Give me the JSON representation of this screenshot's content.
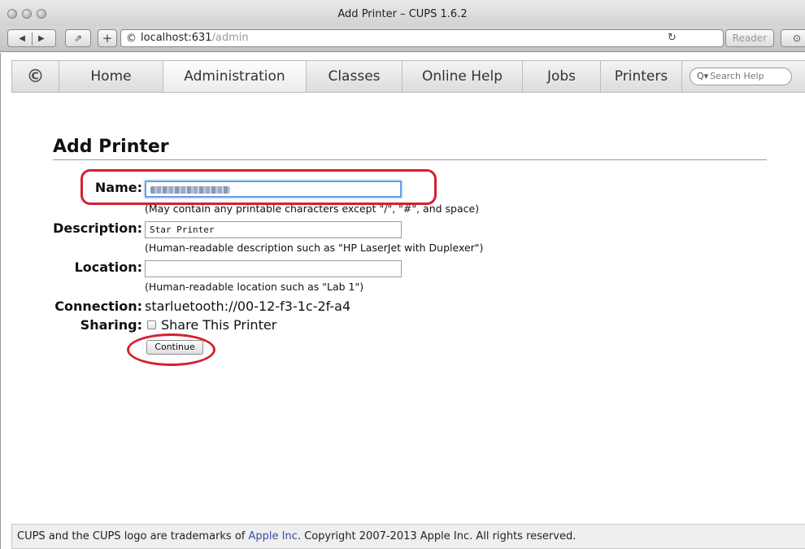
{
  "window": {
    "title": "Add Printer – CUPS 1.6.2"
  },
  "toolbar": {
    "url_host": "localhost:631",
    "url_path": "/admin",
    "reader_label": "Reader"
  },
  "nav": {
    "items": [
      "Home",
      "Administration",
      "Classes",
      "Online Help",
      "Jobs",
      "Printers"
    ],
    "active": "Administration",
    "search_placeholder": "Search Help"
  },
  "page": {
    "heading": "Add Printer"
  },
  "form": {
    "name_label": "Name:",
    "name_hint": "(May contain any printable characters except \"/\", \"#\", and space)",
    "description_label": "Description:",
    "description_value": "Star Printer",
    "description_hint": "(Human-readable description such as \"HP LaserJet with Duplexer\")",
    "location_label": "Location:",
    "location_value": "",
    "location_hint": "(Human-readable location such as \"Lab 1\")",
    "connection_label": "Connection:",
    "connection_value": "starluetooth://00-12-f3-1c-2f-a4",
    "sharing_label": "Sharing:",
    "sharing_option": "Share This Printer",
    "continue_label": "Continue"
  },
  "footer": {
    "prefix": "CUPS and the CUPS logo are trademarks of ",
    "link": "Apple Inc",
    "suffix": ". Copyright 2007-2013 Apple Inc. All rights reserved."
  },
  "colors": {
    "annotation": "#d71f30",
    "link": "#3a4fa8"
  }
}
